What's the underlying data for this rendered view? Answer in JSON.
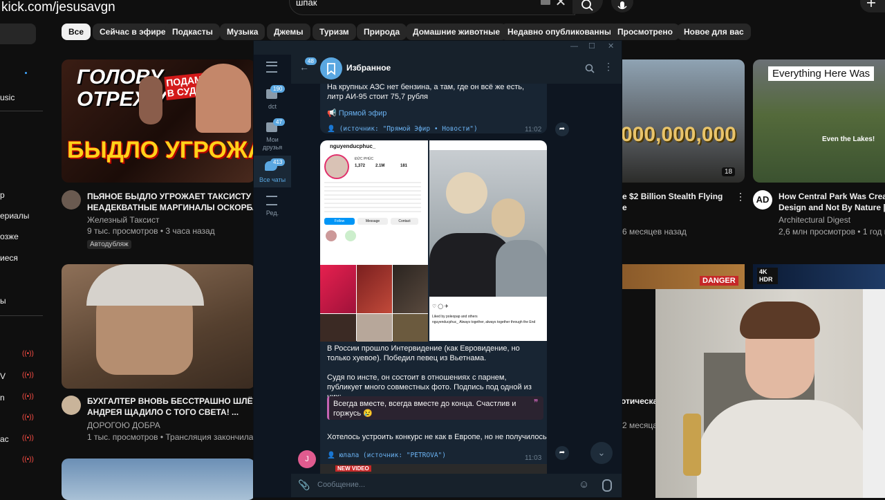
{
  "overlay": {
    "stream_url": "kick.com/jesusavgn"
  },
  "search": {
    "value": "шпак",
    "placeholder": ""
  },
  "sidebar": {
    "items": [
      "usic",
      "р",
      "ериалы",
      "озже",
      "иеся",
      "ы",
      "V",
      "n",
      "ас"
    ]
  },
  "chips": [
    "Все",
    "Сейчас в эфире",
    "Подкасты",
    "Музыка",
    "Джемы",
    "Туризм",
    "Природа",
    "Домашние животные",
    "Недавно опубликованные",
    "Просмотрено",
    "Новое для вас"
  ],
  "videos": [
    {
      "thumb_text_top": "ГОЛОВУ ОТРЕЖУ",
      "thumb_text_tag": "ПОДАМ В СУД",
      "thumb_text_bottom": "БЫДЛО УГРОЖАЕТ",
      "title_1": "ПЬЯНОЕ БЫДЛО УГРОЖАЕТ ТАКСИСТУ |",
      "title_2": "НЕАДЕКВАТНЫЕ МАРГИНАЛЫ ОСКОРБЛЯ",
      "channel": "Железный Таксист",
      "meta": "9 тыс. просмотров • 3 часа назад",
      "badge": "Автодубляж"
    },
    {
      "title_1": "БУХГАЛТЕР ВНОВЬ БЕССТРАШНО ШЛЁТ",
      "title_2": "АНДРЕЯ ЩАДИЛО С ТОГО СВЕТА! ...",
      "channel": "ДОРОГОЮ ДОБРА",
      "meta": "1 тыс. просмотров • Трансляция закончилась 10"
    },
    {
      "thumb_text": "000,000,000",
      "title_1": "e $2 Billion Stealth Flying",
      "title_2": "e",
      "meta": "6 месяцев назад",
      "duration": "18"
    },
    {
      "thumb_text": "Everything Here Was",
      "thumb_sub": "Even the Lakes!",
      "title_1": "How Central Park Was Create",
      "title_2": "Design and Not By Nature | A",
      "channel": "Architectural Digest",
      "meta": "2,6 млн просмотров • 1 год наз"
    },
    {
      "title_1": "отическа",
      "meta": "2 месяца",
      "thumb_tag": "DANGER"
    },
    {
      "thumb_tag": "4K HDR"
    }
  ],
  "telegram": {
    "folders": [
      {
        "label": "dct",
        "badge": "190"
      },
      {
        "label": "Мои друзья",
        "badge": "47"
      },
      {
        "label": "Все чаты",
        "badge": "413"
      },
      {
        "label": "Ред.",
        "badge": ""
      }
    ],
    "back_badge": "48",
    "chat_title": "Избранное",
    "msg1": {
      "text": "На крупных АЗС нет бензина, а там, где он всё же есть, литр АИ-95 стоит 75,7 рубля",
      "link": "Прямой эфир",
      "source": "(источник: \"Прямой Эфир • Новости\")",
      "time": "11:02"
    },
    "insta": {
      "username": "nguyenducphuc_",
      "fullname": "ĐỨC PHÚC",
      "posts": "1,372",
      "followers": "2.1M",
      "following": "181",
      "follow": "Follow",
      "message": "Message",
      "contact": "Contact",
      "liked_by": "Liked by poleopap and others",
      "caption": "nguyenducphuc_ Always together, always together through the End"
    },
    "msg2": {
      "p1": "В России прошло Интервидение (как Евровидение, но только хуевое). Победил певец из Вьетнама.",
      "p2": "Судя по инсте, он состоит в отношениях с парнем, публикует много совместных фото. Подпись под одной из них:",
      "quote": "Всегда вместе, всегда вместе до конца. Счастлив и горжусь 😢",
      "p3": "Хотелось устроить конкурс не как в Европе, но не получилось...",
      "source": "юлала (источник: \"PETROVA\")",
      "time": "11:03",
      "avatar_letter": "J"
    },
    "next_thumb_tag": "NEW VIDEO",
    "input_placeholder": "Сообщение..."
  },
  "colors": {
    "accent": "#5aa7e1",
    "live": "#ff4e45",
    "tg_bg": "#0e1621"
  }
}
